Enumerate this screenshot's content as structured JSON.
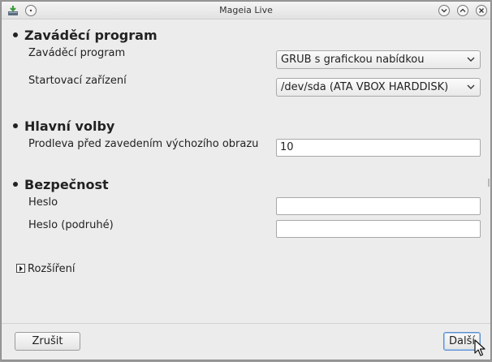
{
  "window": {
    "title": "Mageia Live"
  },
  "sections": {
    "bootloader": {
      "title": "Zaváděcí program",
      "bootloader_label": "Zaváděcí program",
      "bootloader_value": "GRUB s grafickou nabídkou",
      "boot_device_label": "Startovací zařízení",
      "boot_device_value": "/dev/sda (ATA VBOX HARDDISK)"
    },
    "main_options": {
      "title": "Hlavní volby",
      "delay_label": "Prodleva před zavedením výchozího obrazu",
      "delay_value": "10"
    },
    "security": {
      "title": "Bezpečnost",
      "password_label": "Heslo",
      "password_value": "",
      "password_again_label": "Heslo (podruhé)",
      "password_again_value": ""
    }
  },
  "advanced": {
    "label": "Rozšíření"
  },
  "buttons": {
    "cancel": "Zrušit",
    "next": "Další"
  }
}
